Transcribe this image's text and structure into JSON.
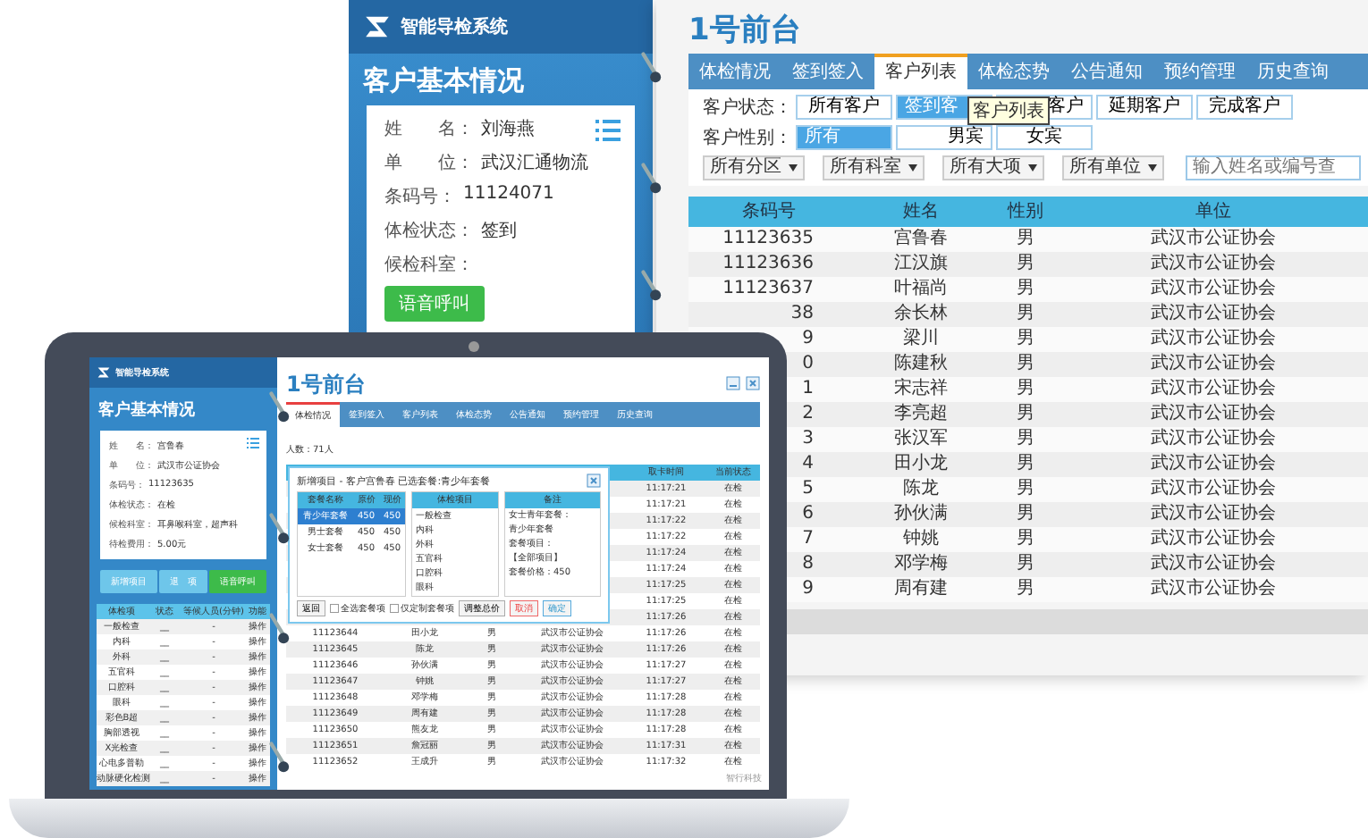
{
  "back_window": {
    "sidebar": {
      "logo": "智能导检系统",
      "title": "客户基本情况",
      "fields": [
        {
          "label": "姓　　名：",
          "value": "刘海燕"
        },
        {
          "label": "单　　位：",
          "value": "武汉汇通物流"
        },
        {
          "label": "条码号：",
          "value": "11124071"
        },
        {
          "label": "体检状态：",
          "value": "签到"
        },
        {
          "label": "候检科室："
        }
      ],
      "call_button": "语音呼叫"
    },
    "title": "1号前台",
    "tabs": [
      {
        "label": "体检情况",
        "selected": false
      },
      {
        "label": "签到签入",
        "selected": false
      },
      {
        "label": "客户列表",
        "selected": true
      },
      {
        "label": "体检态势",
        "selected": false
      },
      {
        "label": "公告通知",
        "selected": false
      },
      {
        "label": "预约管理",
        "selected": false
      },
      {
        "label": "历史查询",
        "selected": false
      }
    ],
    "status_filter": {
      "label": "客户状态：",
      "options": [
        {
          "label": "所有客户",
          "selected": false
        },
        {
          "label": "签到客",
          "selected": true
        },
        {
          "label": "客户",
          "selected": false
        },
        {
          "label": "延期客户",
          "selected": false
        },
        {
          "label": "完成客户",
          "selected": false
        }
      ]
    },
    "tooltip": "客户列表",
    "gender_filter": {
      "label": "客户性别：",
      "options": [
        {
          "label": "所有",
          "selected": true
        },
        {
          "label": "男宾",
          "selected": false
        },
        {
          "label": "女宾",
          "selected": false
        }
      ]
    },
    "dropdowns": [
      "所有分区",
      "所有科室",
      "所有大项",
      "所有单位"
    ],
    "search": {
      "placeholder": "输入姓名或编号查"
    },
    "table": {
      "columns": [
        "条码号",
        "姓名",
        "性别",
        "单位"
      ],
      "rows": [
        [
          "11123635",
          "宫鲁春",
          "男",
          "武汉市公证协会"
        ],
        [
          "11123636",
          "江汉旗",
          "男",
          "武汉市公证协会"
        ],
        [
          "11123637",
          "叶福尚",
          "男",
          "武汉市公证协会"
        ],
        [
          "38",
          "余长林",
          "男",
          "武汉市公证协会"
        ],
        [
          "9",
          "梁川",
          "男",
          "武汉市公证协会"
        ],
        [
          "0",
          "陈建秋",
          "男",
          "武汉市公证协会"
        ],
        [
          "1",
          "宋志祥",
          "男",
          "武汉市公证协会"
        ],
        [
          "2",
          "李亮超",
          "男",
          "武汉市公证协会"
        ],
        [
          "3",
          "张汉军",
          "男",
          "武汉市公证协会"
        ],
        [
          "4",
          "田小龙",
          "男",
          "武汉市公证协会"
        ],
        [
          "5",
          "陈龙",
          "男",
          "武汉市公证协会"
        ],
        [
          "6",
          "孙伙满",
          "男",
          "武汉市公证协会"
        ],
        [
          "7",
          "钟姚",
          "男",
          "武汉市公证协会"
        ],
        [
          "8",
          "邓学梅",
          "男",
          "武汉市公证协会"
        ],
        [
          "9",
          "周有建",
          "男",
          "武汉市公证协会"
        ]
      ]
    }
  },
  "laptop_window": {
    "sidebar": {
      "logo": "智能导检系统",
      "title": "客户基本情况",
      "fields": [
        {
          "label": "姓　　名：",
          "value": "宫鲁春"
        },
        {
          "label": "单　　位：",
          "value": "武汉市公证协会"
        },
        {
          "label": "条码号：",
          "value": "11123635"
        },
        {
          "label": "体检状态：",
          "value": "在检"
        },
        {
          "label": "候检科室：",
          "value": "耳鼻喉科室，超声科"
        },
        {
          "label": "待检费用：",
          "value": "5.00元"
        }
      ],
      "buttons": [
        {
          "label": "新增项目",
          "kind": "light"
        },
        {
          "label": "退　项",
          "kind": "light"
        },
        {
          "label": "语音呼叫",
          "kind": "green"
        }
      ],
      "table": {
        "columns": [
          "体检项",
          "状态",
          "等候人员(分钟)",
          "功能"
        ],
        "rows": [
          [
            "一般检查",
            "__",
            "-",
            "操作"
          ],
          [
            "内科",
            "__",
            "-",
            "操作"
          ],
          [
            "外科",
            "__",
            "-",
            "操作"
          ],
          [
            "五官科",
            "__",
            "-",
            "操作"
          ],
          [
            "口腔科",
            "__",
            "-",
            "操作"
          ],
          [
            "眼科",
            "__",
            "-",
            "操作"
          ],
          [
            "彩色B超",
            "__",
            "-",
            "操作"
          ],
          [
            "胸部透视",
            "__",
            "-",
            "操作"
          ],
          [
            "X光检查",
            "__",
            "-",
            "操作"
          ],
          [
            "心电多普勒",
            "__",
            "-",
            "操作"
          ],
          [
            "动脉硬化检测",
            "__",
            "-",
            "操作"
          ]
        ]
      }
    },
    "title": "1号前台",
    "tabs": [
      {
        "label": "体检情况",
        "selected": true
      },
      {
        "label": "签到签入",
        "selected": false
      },
      {
        "label": "客户列表",
        "selected": false
      },
      {
        "label": "体检态势",
        "selected": false
      },
      {
        "label": "公告通知",
        "selected": false
      },
      {
        "label": "预约管理",
        "selected": false
      },
      {
        "label": "历史查询",
        "selected": false
      }
    ],
    "count": "人数：71人",
    "table": {
      "columns": [
        null,
        null,
        null,
        null,
        "取卡时间",
        "当前状态"
      ],
      "rows": [
        [
          null,
          null,
          null,
          null,
          "11:17:21",
          "在检"
        ],
        [
          null,
          null,
          null,
          null,
          "11:17:21",
          "在检"
        ],
        [
          null,
          null,
          null,
          null,
          "11:17:22",
          "在检"
        ],
        [
          null,
          null,
          null,
          null,
          "11:17:22",
          "在检"
        ],
        [
          null,
          null,
          null,
          null,
          "11:17:24",
          "在检"
        ],
        [
          null,
          null,
          null,
          null,
          "11:17:24",
          "在检"
        ],
        [
          null,
          null,
          null,
          null,
          "11:17:25",
          "在检"
        ],
        [
          null,
          null,
          null,
          null,
          "11:17:25",
          "在检"
        ],
        [
          null,
          null,
          null,
          null,
          "11:17:26",
          "在检"
        ],
        [
          "11123644",
          "田小龙",
          "男",
          "武汉市公证协会",
          "11:17:26",
          "在检"
        ],
        [
          "11123645",
          "陈龙",
          "男",
          "武汉市公证协会",
          "11:17:26",
          "在检"
        ],
        [
          "11123646",
          "孙伙满",
          "男",
          "武汉市公证协会",
          "11:17:27",
          "在检"
        ],
        [
          "11123647",
          "钟姚",
          "男",
          "武汉市公证协会",
          "11:17:27",
          "在检"
        ],
        [
          "11123648",
          "邓学梅",
          "男",
          "武汉市公证协会",
          "11:17:28",
          "在检"
        ],
        [
          "11123649",
          "周有建",
          "男",
          "武汉市公证协会",
          "11:17:28",
          "在检"
        ],
        [
          "11123650",
          "熊友龙",
          "男",
          "武汉市公证协会",
          "11:17:28",
          "在检"
        ],
        [
          "11123651",
          "詹冠丽",
          "男",
          "武汉市公证协会",
          "11:17:31",
          "在检"
        ],
        [
          "11123652",
          "王成升",
          "男",
          "武汉市公证协会",
          "11:17:32",
          "在检"
        ]
      ]
    },
    "dialog": {
      "title": "新增项目 - 客户宫鲁春  已选套餐:青少年套餐",
      "packages": {
        "columns": [
          "套餐名称",
          "原价",
          "现价"
        ],
        "rows": [
          {
            "cells": [
              "青少年套餐",
              "450",
              "450"
            ],
            "selected": true
          },
          {
            "cells": [
              "男士套餐",
              "450",
              "450"
            ],
            "selected": false
          },
          {
            "cells": [
              "女士套餐",
              "450",
              "450"
            ],
            "selected": false
          }
        ]
      },
      "items": {
        "header": "体检项目",
        "rows": [
          "一般检查",
          "内科",
          "外科",
          "五官科",
          "口腔科",
          "眼科"
        ]
      },
      "notes": {
        "header": "备注",
        "lines": [
          "女士青年套餐：",
          "青少年套餐",
          "套餐项目：",
          "【全部项目】",
          "套餐价格：450"
        ]
      },
      "footer": [
        {
          "kind": "button",
          "label": "返回"
        },
        {
          "kind": "checkbox",
          "label": "全选套餐项",
          "checked": false
        },
        {
          "kind": "checkbox",
          "label": "仅定制套餐项",
          "checked": false
        },
        {
          "kind": "button",
          "label": "调整总价"
        },
        {
          "kind": "cancel",
          "label": "取消"
        },
        {
          "kind": "ok",
          "label": "确定"
        }
      ]
    },
    "footer_text": "智行科技"
  }
}
